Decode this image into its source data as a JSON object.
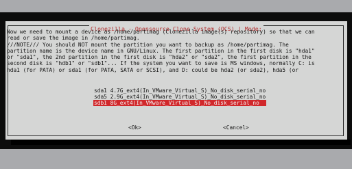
{
  "dialog": {
    "title": "Clonezilla - Opensource Clone System (OCS) | Mode:",
    "message_lines": [
      "Now we need to mount a device as /home/partimag (Clonezilla image(s) repository) so that we can",
      "read or save the image in /home/partimag.",
      "///NOTE/// You should NOT mount the partition you want to backup as /home/partimag. The",
      "partition name is the device name in GNU/Linux. The first partition in the first disk is \"hda1\"",
      "or \"sda1\", the 2nd partition in the first disk is \"hda2\" or \"sda2\", the first partition in the",
      "second disk is \"hdb1\" or \"sdb1\"... If the system you want to save is MS windows, normally C: is",
      "hda1 (for PATA) or sda1 (for PATA, SATA or SCSI), and D: could be hda2 (or sda2), hda5 (or"
    ],
    "options": [
      {
        "label": "sda1 4.7G_ext4(In_VMware_Virtual_S)_No_disk_serial_no",
        "selected": false
      },
      {
        "label": "sda5 2.9G_ext4(In_VMware_Virtual_S)_No_disk_serial_no",
        "selected": false
      },
      {
        "label": "sdb1 8G_ext4(In_VMware_Virtual_S)_No_disk_serial_no",
        "selected": true
      }
    ],
    "buttons": {
      "ok": "<Ok>",
      "cancel": "<Cancel>"
    }
  },
  "colors": {
    "background": "#a9aaad",
    "dialog": "#d5d6d5",
    "title": "#b32c2c",
    "selection": "#d1282b"
  }
}
